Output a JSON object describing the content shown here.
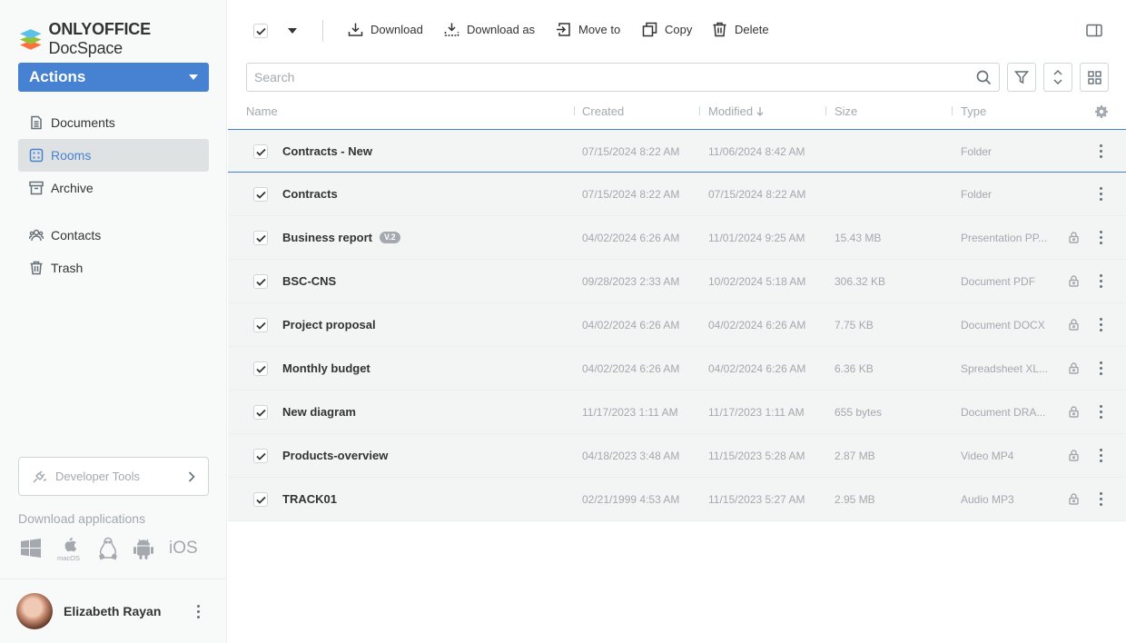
{
  "brand": {
    "name_bold": "ONLYOFFICE",
    "name_regular": "DocSpace"
  },
  "sidebar": {
    "actions_label": "Actions",
    "items": [
      {
        "label": "Documents",
        "icon": "document-icon"
      },
      {
        "label": "Rooms",
        "icon": "rooms-icon",
        "active": true
      },
      {
        "label": "Archive",
        "icon": "archive-icon"
      },
      {
        "label": "Contacts",
        "icon": "contacts-icon"
      },
      {
        "label": "Trash",
        "icon": "trash-icon"
      }
    ],
    "developer_tools": "Developer Tools",
    "download_title": "Download applications",
    "apps": [
      "windows",
      "macOS",
      "linux",
      "android",
      "iOS"
    ],
    "user": {
      "name": "Elizabeth Rayan"
    }
  },
  "toolbar": {
    "download": "Download",
    "download_as": "Download as",
    "move_to": "Move to",
    "copy": "Copy",
    "delete": "Delete"
  },
  "search": {
    "placeholder": "Search",
    "value": ""
  },
  "table": {
    "columns": {
      "name": "Name",
      "created": "Created",
      "modified": "Modified",
      "size": "Size",
      "type": "Type"
    },
    "sort": {
      "column": "modified",
      "direction": "desc"
    },
    "rows": [
      {
        "name": "Contracts - New",
        "badge": "",
        "created": "07/15/2024 8:22 AM",
        "modified": "11/06/2024 8:42 AM",
        "size": "",
        "type": "Folder",
        "locked": false,
        "checked": true
      },
      {
        "name": "Contracts",
        "badge": "",
        "created": "07/15/2024 8:22 AM",
        "modified": "07/15/2024 8:22 AM",
        "size": "",
        "type": "Folder",
        "locked": false,
        "checked": true
      },
      {
        "name": "Business report",
        "badge": "V.2",
        "created": "04/02/2024 6:26 AM",
        "modified": "11/01/2024 9:25 AM",
        "size": "15.43 MB",
        "type": "Presentation PP...",
        "locked": true,
        "checked": true
      },
      {
        "name": "BSC-CNS",
        "badge": "",
        "created": "09/28/2023 2:33 AM",
        "modified": "10/02/2024 5:18 AM",
        "size": "306.32 KB",
        "type": "Document PDF",
        "locked": true,
        "checked": true
      },
      {
        "name": "Project proposal",
        "badge": "",
        "created": "04/02/2024 6:26 AM",
        "modified": "04/02/2024 6:26 AM",
        "size": "7.75 KB",
        "type": "Document DOCX",
        "locked": true,
        "checked": true
      },
      {
        "name": "Monthly budget",
        "badge": "",
        "created": "04/02/2024 6:26 AM",
        "modified": "04/02/2024 6:26 AM",
        "size": "6.36 KB",
        "type": "Spreadsheet XL...",
        "locked": true,
        "checked": true
      },
      {
        "name": "New diagram",
        "badge": "",
        "created": "11/17/2023 1:11 AM",
        "modified": "11/17/2023 1:11 AM",
        "size": "655 bytes",
        "type": "Document DRA...",
        "locked": true,
        "checked": true
      },
      {
        "name": "Products-overview",
        "badge": "",
        "created": "04/18/2023 3:48 AM",
        "modified": "11/15/2023 5:28 AM",
        "size": "2.87 MB",
        "type": "Video MP4",
        "locked": true,
        "checked": true
      },
      {
        "name": "TRACK01",
        "badge": "",
        "created": "02/21/1999 4:53 AM",
        "modified": "11/15/2023 5:27 AM",
        "size": "2.95 MB",
        "type": "Audio MP3",
        "locked": true,
        "checked": true
      }
    ]
  },
  "colors": {
    "accent": "#4781d1",
    "muted": "#a3a9ae",
    "border": "#d0d5da"
  }
}
